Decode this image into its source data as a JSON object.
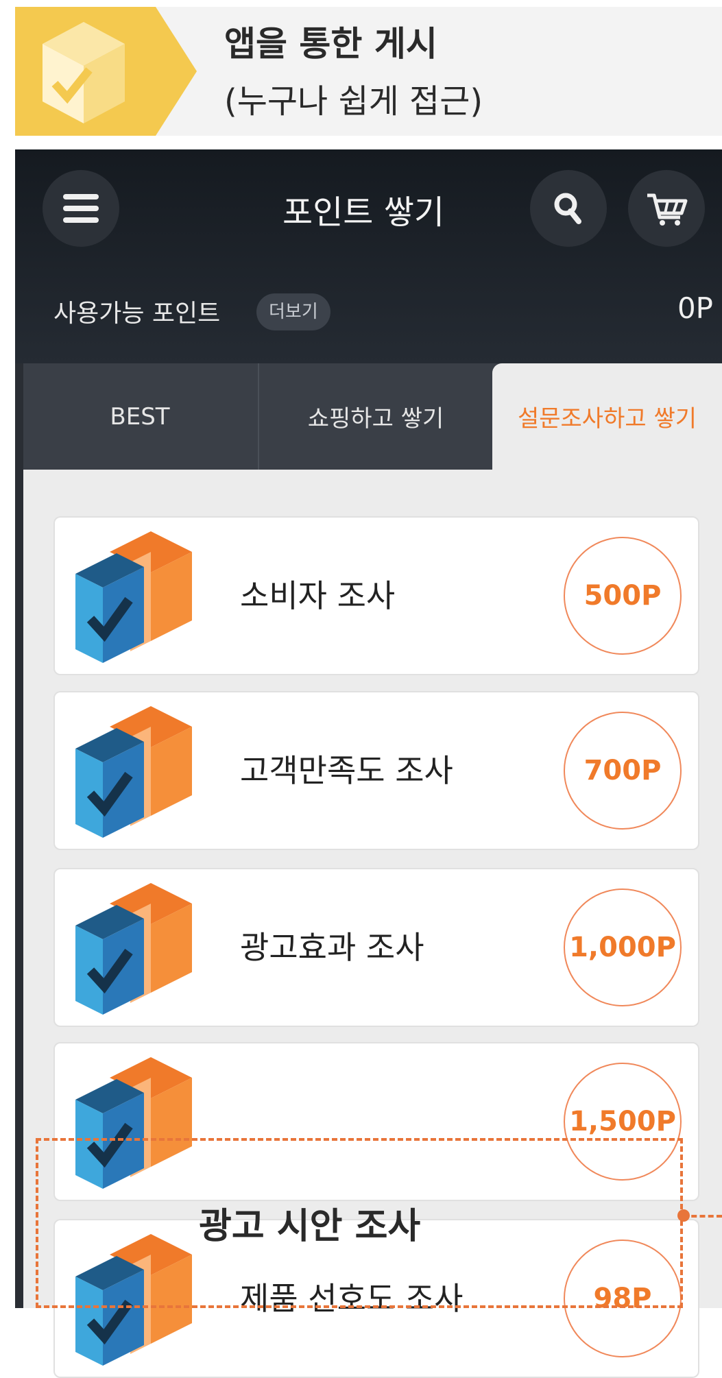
{
  "banner": {
    "title": "앱을 통한 게시",
    "subtitle": "(누구나 쉽게 접근)"
  },
  "app": {
    "title": "포인트 쌓기",
    "menu_icon": "hamburger-icon",
    "search_icon": "search-icon",
    "cart_icon": "cart-icon"
  },
  "points": {
    "label": "사용가능 포인트",
    "more": "더보기",
    "value": "0P"
  },
  "tabs": [
    {
      "label": "BEST",
      "active": false
    },
    {
      "label": "쇼핑하고 쌓기",
      "active": false
    },
    {
      "label": "설문조사하고 쌓기",
      "active": true
    }
  ],
  "surveys": [
    {
      "title": "소비자 조사",
      "points": "500P"
    },
    {
      "title": "고객만족도 조사",
      "points": "700P"
    },
    {
      "title": "광고효과 조사",
      "points": "1,000P"
    },
    {
      "title": "",
      "points": "1,500P"
    },
    {
      "title": "제품 선호도 조사",
      "points": "98P"
    }
  ],
  "annotation": {
    "label": "광고 시안 조사"
  },
  "colors": {
    "accent": "#f07a2a",
    "banner_yellow": "#f4c94f",
    "header_dark": "#1b2027",
    "icon_blue": "#2a78b8",
    "icon_orange": "#f08a2c"
  }
}
